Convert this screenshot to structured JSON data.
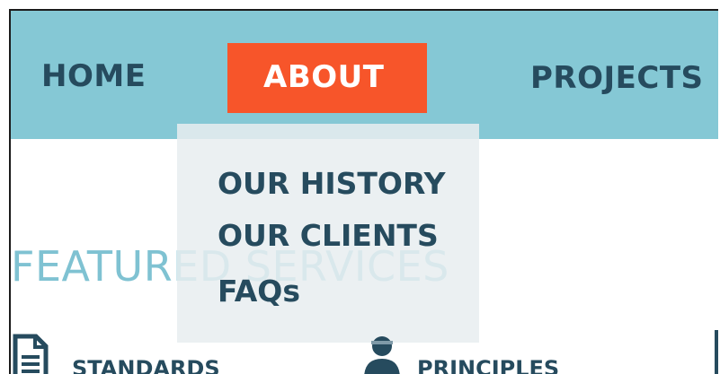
{
  "nav": {
    "items": [
      {
        "label": "HOME"
      },
      {
        "label": "ABOUT",
        "active": true
      },
      {
        "label": "PROJECTS"
      }
    ]
  },
  "dropdown": {
    "items": [
      {
        "label": "OUR HISTORY"
      },
      {
        "label": "OUR CLIENTS"
      },
      {
        "label": "FAQs"
      }
    ]
  },
  "section": {
    "title": "FEATURED SERVICES"
  },
  "services": [
    {
      "label": "STANDARDS",
      "icon": "document-icon"
    },
    {
      "label": "PRINCIPLES",
      "icon": "person-icon"
    }
  ],
  "colors": {
    "nav_bg": "#85c8d5",
    "active_bg": "#f7552a",
    "text_dark": "#264b5e",
    "title_light": "#7fc2d2",
    "dropdown_bg": "#e8eef0"
  }
}
